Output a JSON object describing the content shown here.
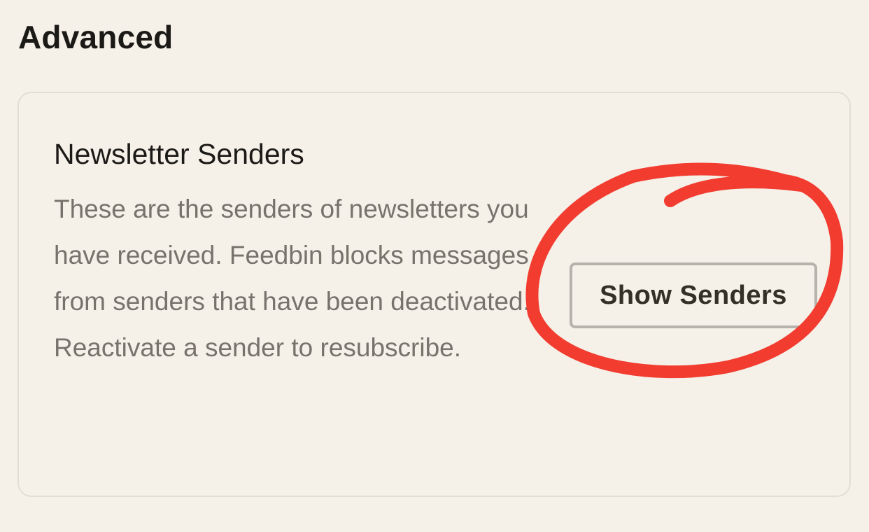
{
  "section": {
    "heading": "Advanced"
  },
  "card": {
    "title": "Newsletter Senders",
    "description": "These are the senders of newsletters you have received. Feedbin blocks messages from senders that have been deactivated. Reactivate a sender to resubscribe.",
    "button_label": "Show Senders"
  },
  "annotation": {
    "color": "#f23c30"
  },
  "colors": {
    "background": "#f5f1e9",
    "text_primary": "#1c1a17",
    "text_secondary": "#77726b",
    "border": "#e2ded6",
    "button_border": "#b7b3ac"
  }
}
